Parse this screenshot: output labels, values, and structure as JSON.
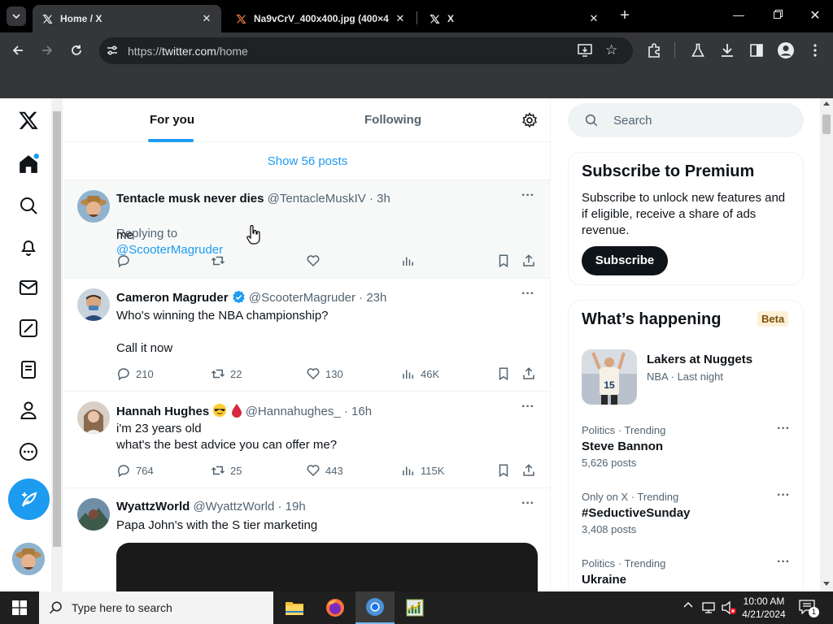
{
  "browser": {
    "tabs": [
      {
        "title": "Home / X",
        "active": true
      },
      {
        "title": "Na9vCrV_400x400.jpg (400×4",
        "active": false
      },
      {
        "title": "X",
        "active": false
      }
    ],
    "url_scheme": "https://",
    "url_host": "twitter.com",
    "url_path": "/home"
  },
  "timeline": {
    "tab_for_you": "For you",
    "tab_following": "Following",
    "show_posts": "Show 56 posts",
    "posts": [
      {
        "name": "Tentacle musk never dies",
        "handle": "@TentacleMuskIV",
        "time": "· 3h",
        "replying_label": "Replying to",
        "replying_to": "@ScooterMagruder",
        "text": "me",
        "replies": "",
        "reposts": "",
        "likes": "",
        "views": ""
      },
      {
        "name": "Cameron Magruder",
        "handle": "@ScooterMagruder",
        "time": "· 23h",
        "verified": true,
        "text": "Who's winning the NBA championship?\n\nCall it now",
        "replies": "210",
        "reposts": "22",
        "likes": "130",
        "views": "46K"
      },
      {
        "name": "Hannah Hughes",
        "handle": "@Hannahughes_",
        "time": "· 16h",
        "text": "i'm 23 years old\nwhat's the best advice you can offer me?",
        "replies": "764",
        "reposts": "25",
        "likes": "443",
        "views": "115K"
      },
      {
        "name": "WyattzWorld",
        "handle": "@WyattzWorld",
        "time": "· 19h",
        "text": "Papa John's with the S tier marketing"
      }
    ]
  },
  "sidebar": {
    "search_placeholder": "Search",
    "premium": {
      "title": "Subscribe to Premium",
      "text": "Subscribe to unlock new features and if eligible, receive a share of ads revenue.",
      "button": "Subscribe"
    },
    "happening": {
      "title": "What’s happening",
      "badge": "Beta",
      "event_title": "Lakers at Nuggets",
      "event_meta": "NBA · Last night",
      "trends": [
        {
          "meta": "Politics · Trending",
          "title": "Steve Bannon",
          "count": "5,626 posts"
        },
        {
          "meta": "Only on X · Trending",
          "title": "#SeductiveSunday",
          "count": "3,408 posts"
        },
        {
          "meta": "Politics · Trending",
          "title": "Ukraine",
          "count": ""
        }
      ]
    }
  },
  "taskbar": {
    "search_placeholder": "Type here to search",
    "time": "10:00 AM",
    "date": "4/21/2024",
    "notification_count": "1"
  },
  "colors": {
    "accent": "#1d9bf0",
    "text": "#0f1419",
    "muted": "#536471",
    "verified": "#1d9bf0"
  }
}
